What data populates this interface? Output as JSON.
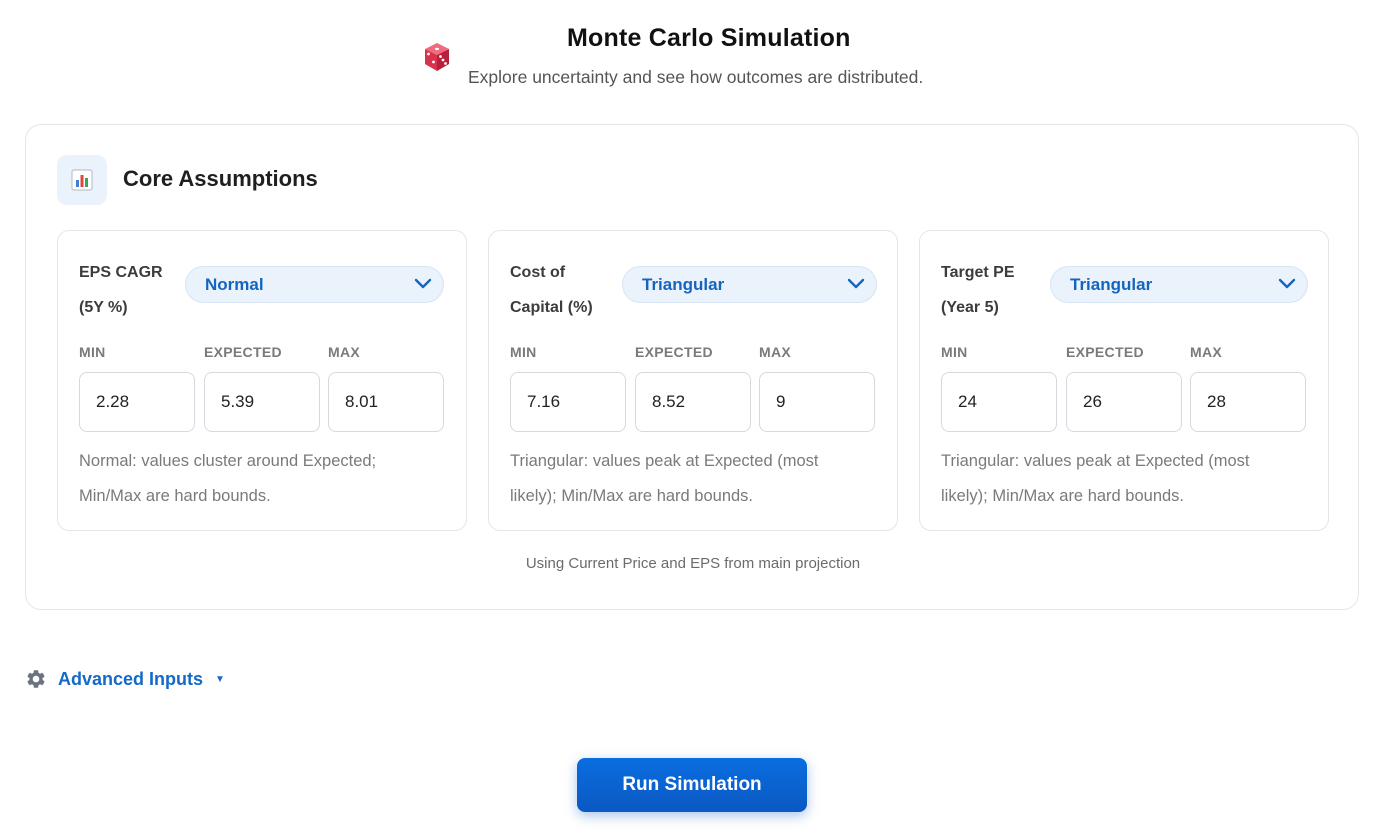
{
  "header": {
    "icon": "dice-icon",
    "title": "Monte Carlo Simulation",
    "subtitle": "Explore uncertainty and see how outcomes are distributed."
  },
  "core": {
    "icon": "bar-chart-icon",
    "title": "Core Assumptions",
    "panels": [
      {
        "label_line1": "EPS CAGR",
        "label_line2": "(5Y %)",
        "distribution": "Normal",
        "min_label": "MIN",
        "expected_label": "EXPECTED",
        "max_label": "MAX",
        "min": "2.28",
        "expected": "5.39",
        "max": "8.01",
        "hint_line1": "Normal: values cluster around Expected;",
        "hint_line2": "Min/Max are hard bounds."
      },
      {
        "label_line1": "Cost of",
        "label_line2": "Capital (%)",
        "distribution": "Triangular",
        "min_label": "MIN",
        "expected_label": "EXPECTED",
        "max_label": "MAX",
        "min": "7.16",
        "expected": "8.52",
        "max": "9",
        "hint_line1": "Triangular: values peak at Expected (most",
        "hint_line2": "likely); Min/Max are hard bounds."
      },
      {
        "label_line1": "Target PE",
        "label_line2": "(Year 5)",
        "distribution": "Triangular",
        "min_label": "MIN",
        "expected_label": "EXPECTED",
        "max_label": "MAX",
        "min": "24",
        "expected": "26",
        "max": "28",
        "hint_line1": "Triangular: values peak at Expected (most",
        "hint_line2": "likely); Min/Max are hard bounds."
      }
    ],
    "footnote": "Using Current Price and EPS from main projection"
  },
  "advanced": {
    "icon": "gear-icon",
    "label": "Advanced Inputs",
    "caret": "▼"
  },
  "actions": {
    "run_label": "Run Simulation"
  },
  "colors": {
    "accent": "#1569c7",
    "button": "#0b63d1",
    "select_bg": "#eaf2fb"
  }
}
